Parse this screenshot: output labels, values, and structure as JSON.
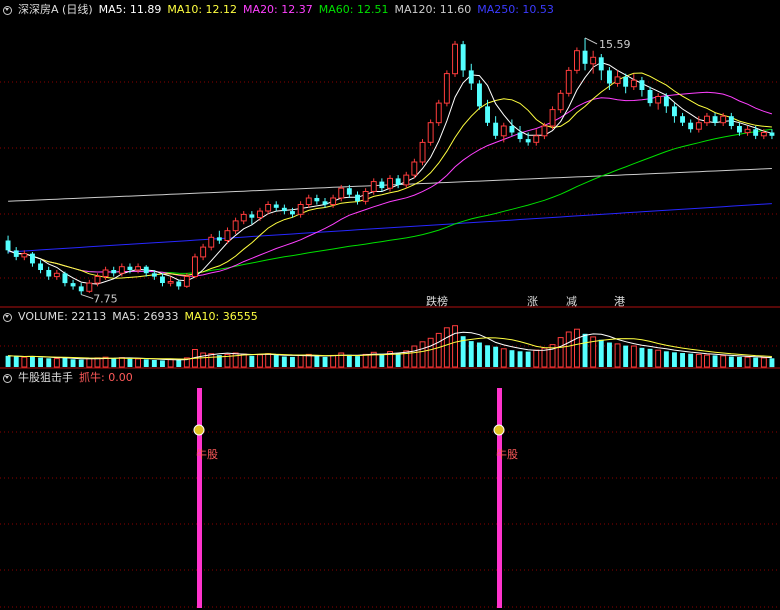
{
  "colors": {
    "up": "#ff3d3d",
    "down": "#54ffff",
    "ma5": "#ffffff",
    "ma10": "#ffff40",
    "ma20": "#ff40ff",
    "ma60": "#00e000",
    "ma120": "#cccccc",
    "ma250": "#2727ff",
    "grid": "#8b0000",
    "signal": "#ff33cc"
  },
  "main_legend": {
    "title": "深深房A (日线)",
    "ma5": "MA5: 11.89",
    "ma10": "MA10: 12.12",
    "ma20": "MA20: 12.37",
    "ma60": "MA60: 12.51",
    "ma120": "MA120: 11.60",
    "ma250": "MA250: 10.53"
  },
  "volume_legend": {
    "volume": "VOLUME: 22113",
    "ma5": "MA5: 26933",
    "ma10": "MA10: 36555"
  },
  "indicator_legend": {
    "name": "牛股狙击手",
    "value": "抓牛: 0.00"
  },
  "annotations": {
    "high": "15.59",
    "low": "7.75"
  },
  "events": [
    {
      "label": "跌榜",
      "color": "#00e000"
    },
    {
      "label": "涨",
      "color": "#ff4040"
    },
    {
      "label": "减",
      "color": "#00e000"
    },
    {
      "label": "港",
      "color": "#00e000"
    }
  ],
  "signals": [
    {
      "label": "牛股"
    },
    {
      "label": "牛股"
    }
  ],
  "chart_data": [
    {
      "type": "candlestick",
      "title": "深深房A (日线)",
      "ylim": [
        7.4,
        16.2
      ],
      "candles": [
        [
          9.4,
          9.1,
          9.55,
          9.0
        ],
        [
          9.1,
          8.9,
          9.2,
          8.8
        ],
        [
          8.9,
          9.0,
          9.1,
          8.8
        ],
        [
          9.0,
          8.7,
          9.05,
          8.6
        ],
        [
          8.7,
          8.5,
          8.8,
          8.4
        ],
        [
          8.5,
          8.3,
          8.6,
          8.2
        ],
        [
          8.3,
          8.4,
          8.5,
          8.2
        ],
        [
          8.4,
          8.1,
          8.45,
          8.0
        ],
        [
          8.1,
          8.0,
          8.2,
          7.9
        ],
        [
          8.0,
          7.85,
          8.1,
          7.75
        ],
        [
          7.85,
          8.1,
          8.2,
          7.8
        ],
        [
          8.1,
          8.3,
          8.4,
          8.0
        ],
        [
          8.3,
          8.5,
          8.6,
          8.2
        ],
        [
          8.5,
          8.4,
          8.6,
          8.3
        ],
        [
          8.4,
          8.6,
          8.7,
          8.3
        ],
        [
          8.6,
          8.5,
          8.7,
          8.4
        ],
        [
          8.5,
          8.6,
          8.7,
          8.4
        ],
        [
          8.6,
          8.4,
          8.65,
          8.3
        ],
        [
          8.4,
          8.3,
          8.5,
          8.2
        ],
        [
          8.3,
          8.1,
          8.4,
          8.0
        ],
        [
          8.1,
          8.15,
          8.3,
          8.0
        ],
        [
          8.15,
          8.0,
          8.2,
          7.9
        ],
        [
          8.0,
          8.3,
          8.4,
          7.95
        ],
        [
          8.3,
          8.9,
          9.0,
          8.25
        ],
        [
          8.9,
          9.2,
          9.3,
          8.8
        ],
        [
          9.2,
          9.5,
          9.6,
          9.1
        ],
        [
          9.5,
          9.4,
          9.7,
          9.3
        ],
        [
          9.4,
          9.7,
          9.8,
          9.3
        ],
        [
          9.7,
          10.0,
          10.1,
          9.6
        ],
        [
          10.0,
          10.2,
          10.3,
          9.9
        ],
        [
          10.2,
          10.1,
          10.3,
          9.9
        ],
        [
          10.1,
          10.3,
          10.4,
          10.0
        ],
        [
          10.3,
          10.5,
          10.6,
          10.2
        ],
        [
          10.5,
          10.4,
          10.6,
          10.3
        ],
        [
          10.4,
          10.3,
          10.5,
          10.2
        ],
        [
          10.3,
          10.2,
          10.4,
          10.1
        ],
        [
          10.2,
          10.5,
          10.6,
          10.1
        ],
        [
          10.5,
          10.7,
          10.8,
          10.4
        ],
        [
          10.7,
          10.6,
          10.8,
          10.5
        ],
        [
          10.6,
          10.5,
          10.7,
          10.4
        ],
        [
          10.5,
          10.7,
          10.8,
          10.4
        ],
        [
          10.7,
          11.0,
          11.1,
          10.6
        ],
        [
          11.0,
          10.8,
          11.1,
          10.7
        ],
        [
          10.8,
          10.6,
          10.9,
          10.5
        ],
        [
          10.6,
          10.9,
          11.0,
          10.5
        ],
        [
          10.9,
          11.2,
          11.3,
          10.8
        ],
        [
          11.2,
          11.0,
          11.3,
          10.9
        ],
        [
          11.0,
          11.3,
          11.4,
          10.9
        ],
        [
          11.3,
          11.1,
          11.4,
          11.0
        ],
        [
          11.1,
          11.4,
          11.5,
          11.0
        ],
        [
          11.4,
          11.8,
          11.9,
          11.3
        ],
        [
          11.8,
          12.4,
          12.5,
          11.7
        ],
        [
          12.4,
          13.0,
          13.1,
          12.3
        ],
        [
          13.0,
          13.6,
          13.7,
          12.9
        ],
        [
          13.6,
          14.5,
          14.6,
          13.5
        ],
        [
          14.5,
          15.4,
          15.5,
          14.4
        ],
        [
          15.4,
          14.6,
          15.5,
          14.4
        ],
        [
          14.6,
          14.2,
          14.8,
          14.0
        ],
        [
          14.2,
          13.5,
          14.3,
          13.4
        ],
        [
          13.5,
          13.0,
          13.7,
          12.9
        ],
        [
          13.0,
          12.6,
          13.2,
          12.5
        ],
        [
          12.6,
          12.9,
          13.0,
          12.4
        ],
        [
          12.9,
          12.7,
          13.1,
          12.6
        ],
        [
          12.7,
          12.5,
          12.9,
          12.4
        ],
        [
          12.5,
          12.4,
          12.7,
          12.3
        ],
        [
          12.4,
          12.6,
          12.8,
          12.3
        ],
        [
          12.6,
          12.9,
          13.0,
          12.5
        ],
        [
          12.9,
          13.4,
          13.5,
          12.8
        ],
        [
          13.4,
          13.9,
          14.0,
          13.3
        ],
        [
          13.9,
          14.6,
          14.7,
          13.8
        ],
        [
          14.6,
          15.2,
          15.3,
          14.5
        ],
        [
          15.2,
          14.8,
          15.59,
          14.6
        ],
        [
          14.8,
          15.0,
          15.2,
          14.5
        ],
        [
          15.0,
          14.6,
          15.1,
          14.3
        ],
        [
          14.6,
          14.2,
          14.7,
          14.0
        ],
        [
          14.2,
          14.4,
          14.6,
          14.1
        ],
        [
          14.4,
          14.1,
          14.5,
          13.9
        ],
        [
          14.1,
          14.3,
          14.5,
          14.0
        ],
        [
          14.3,
          14.0,
          14.4,
          13.8
        ],
        [
          14.0,
          13.6,
          14.1,
          13.5
        ],
        [
          13.6,
          13.8,
          13.9,
          13.4
        ],
        [
          13.8,
          13.5,
          13.9,
          13.3
        ],
        [
          13.5,
          13.2,
          13.6,
          13.0
        ],
        [
          13.2,
          13.0,
          13.3,
          12.9
        ],
        [
          13.0,
          12.8,
          13.1,
          12.7
        ],
        [
          12.8,
          13.0,
          13.2,
          12.7
        ],
        [
          13.0,
          13.2,
          13.3,
          12.9
        ],
        [
          13.2,
          13.0,
          13.3,
          12.9
        ],
        [
          13.0,
          13.2,
          13.3,
          12.9
        ],
        [
          13.2,
          12.9,
          13.3,
          12.8
        ],
        [
          12.9,
          12.7,
          13.0,
          12.6
        ],
        [
          12.7,
          12.8,
          12.9,
          12.6
        ],
        [
          12.8,
          12.6,
          12.9,
          12.5
        ],
        [
          12.6,
          12.7,
          12.8,
          12.5
        ],
        [
          12.7,
          12.6,
          12.8,
          12.5
        ]
      ],
      "ma_periods": {
        "ma5": 5,
        "ma10": 10,
        "ma20": 20,
        "ma60": 60
      },
      "ma120": [
        10.6,
        11.6
      ],
      "ma250": [
        9.05,
        10.53
      ]
    },
    {
      "type": "bar",
      "title": "VOLUME",
      "ylim": [
        0,
        120000
      ],
      "values": [
        32000,
        30000,
        28000,
        31000,
        27000,
        25000,
        24000,
        26000,
        22000,
        21000,
        24000,
        26000,
        28000,
        25000,
        27000,
        24000,
        23000,
        22000,
        20000,
        19000,
        21000,
        20000,
        26000,
        50000,
        40000,
        38000,
        34000,
        36000,
        40000,
        37000,
        32000,
        35000,
        38000,
        34000,
        30000,
        29000,
        33000,
        36000,
        31000,
        29000,
        33000,
        40000,
        35000,
        31000,
        36000,
        42000,
        38000,
        44000,
        40000,
        46000,
        60000,
        72000,
        82000,
        96000,
        112000,
        118000,
        88000,
        74000,
        70000,
        62000,
        58000,
        52000,
        48000,
        45000,
        44000,
        48000,
        54000,
        64000,
        84000,
        100000,
        108000,
        95000,
        86000,
        78000,
        70000,
        66000,
        61000,
        60000,
        55000,
        52000,
        48000,
        45000,
        42000,
        40000,
        38000,
        36000,
        34000,
        33000,
        32000,
        30000,
        29000,
        28000,
        27000,
        26000,
        25000
      ]
    },
    {
      "type": "bar",
      "title": "牛股狙击手",
      "series": [
        {
          "name": "抓牛",
          "values": [
            0,
            0
          ]
        }
      ]
    }
  ]
}
